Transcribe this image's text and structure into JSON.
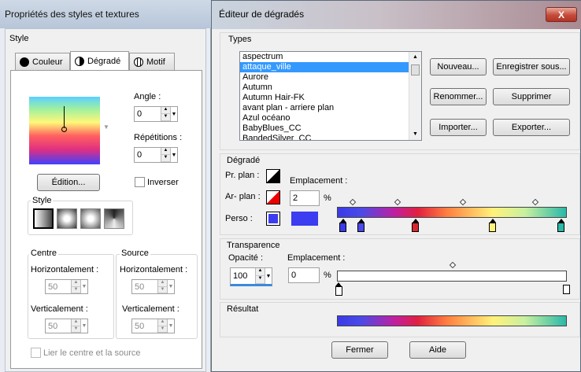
{
  "background_window": {
    "title": "Propriétés des styles et textures",
    "style_label": "Style",
    "tabs": [
      {
        "label": "Couleur",
        "icon": "solid-circle-icon"
      },
      {
        "label": "Dégradé",
        "icon": "half-circle-icon"
      },
      {
        "label": "Motif",
        "icon": "globe-icon"
      }
    ],
    "angle_label": "Angle :",
    "angle_value": "0",
    "repetitions_label": "Répétitions :",
    "repetitions_value": "0",
    "edit_button": "Édition...",
    "invert_label": "Inverser",
    "style_group_label": "Style",
    "centre_label": "Centre",
    "source_label": "Source",
    "horizontal_label": "Horizontalement :",
    "vertical_label": "Verticalement :",
    "centre_h": "50",
    "centre_v": "50",
    "source_h": "50",
    "source_v": "50",
    "link_label": "Lier le centre et la source"
  },
  "dialog": {
    "title": "Éditeur de dégradés",
    "close_glyph": "X",
    "types_label": "Types",
    "presets": [
      "aspectrum",
      "attaque_ville",
      "Aurore",
      "Autumn",
      "Autumn Hair-FK",
      "avant plan - arriere plan",
      "Azul océano",
      "BabyBlues_CC",
      "BandedSilver_CC"
    ],
    "selected_preset": "attaque_ville",
    "buttons": {
      "new": "Nouveau...",
      "save_as": "Enregistrer sous...",
      "rename": "Renommer...",
      "delete": "Supprimer",
      "import": "Importer...",
      "export": "Exporter..."
    },
    "gradient_label": "Dégradé",
    "fg_label": "Pr. plan :",
    "bg_label": "Ar- plan :",
    "custom_label": "Perso :",
    "location_label": "Emplacement :",
    "location_value": "2",
    "percent": "%",
    "custom_color": "#3c3cf0",
    "transparency_label": "Transparence",
    "opacity_label": "Opacité :",
    "opacity_value": "100",
    "t_location_label": "Emplacement :",
    "t_location_value": "0",
    "result_label": "Résultat",
    "ok_button": "Fermer",
    "help_button": "Aide",
    "color_stops": [
      "#3a3ae8",
      "#4a4ae8",
      "#d82830",
      "#fff27a",
      "#2ab8a8"
    ]
  }
}
